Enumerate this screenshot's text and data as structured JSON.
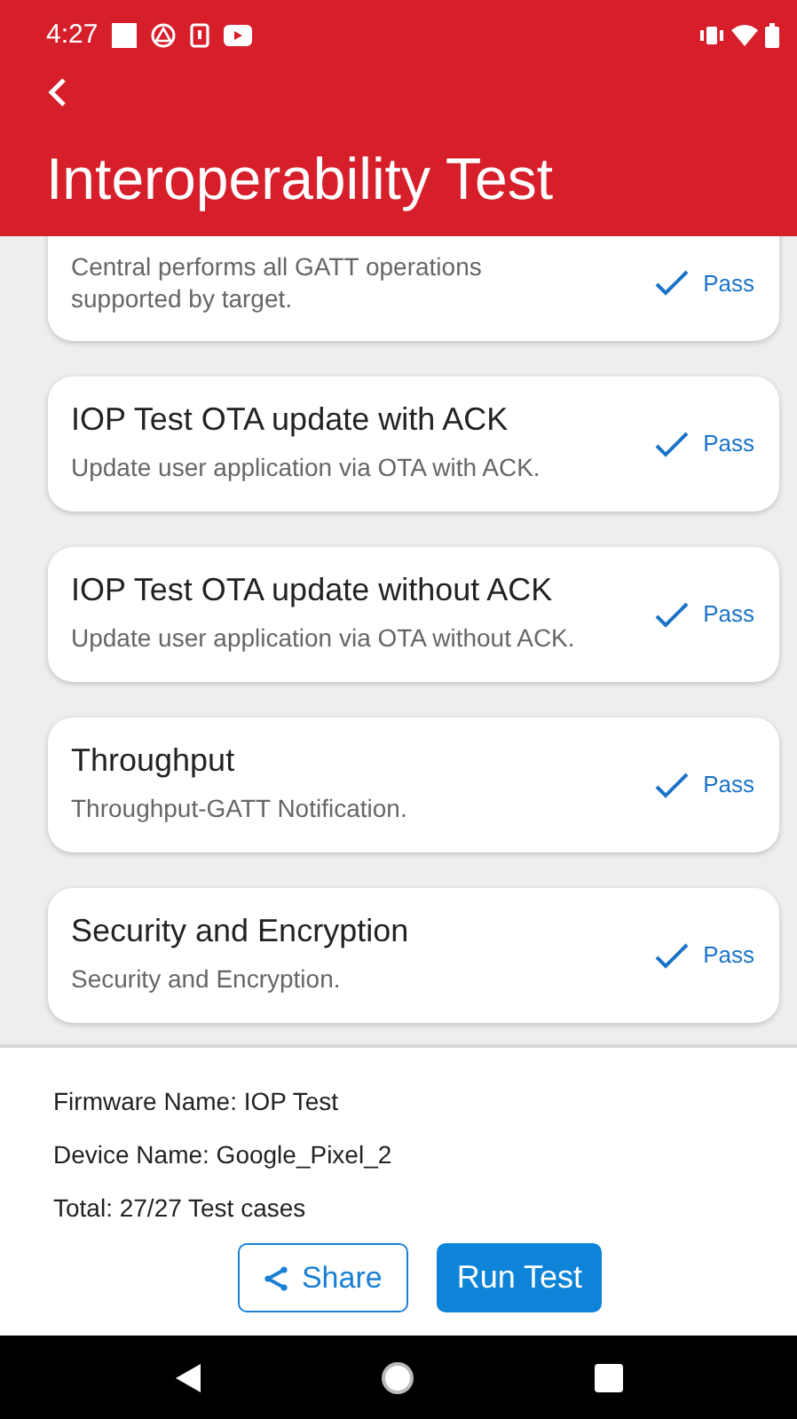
{
  "status_bar": {
    "time": "4:27"
  },
  "header": {
    "title": "Interoperability Test"
  },
  "tests": [
    {
      "description": "Central performs all GATT operations supported by target.",
      "result": "Pass",
      "passed": true
    },
    {
      "title": "IOP Test OTA update with ACK",
      "description": "Update user application via OTA with ACK.",
      "result": "Pass",
      "passed": true
    },
    {
      "title": "IOP Test OTA update without ACK",
      "description": "Update user application via OTA without ACK.",
      "result": "Pass",
      "passed": true
    },
    {
      "title": "Throughput",
      "description": "Throughput-GATT Notification.",
      "result": "Pass",
      "passed": true
    },
    {
      "title": "Security and Encryption",
      "description": "Security and Encryption.",
      "result": "Pass",
      "passed": true
    }
  ],
  "summary": [
    "Firmware Name: IOP Test",
    "Device Name: Google_Pixel_2",
    "Total: 27/27 Test cases"
  ],
  "buttons": [
    {
      "kind": "outline",
      "label": "Share"
    },
    {
      "kind": "solid",
      "label": "Run Test"
    }
  ]
}
